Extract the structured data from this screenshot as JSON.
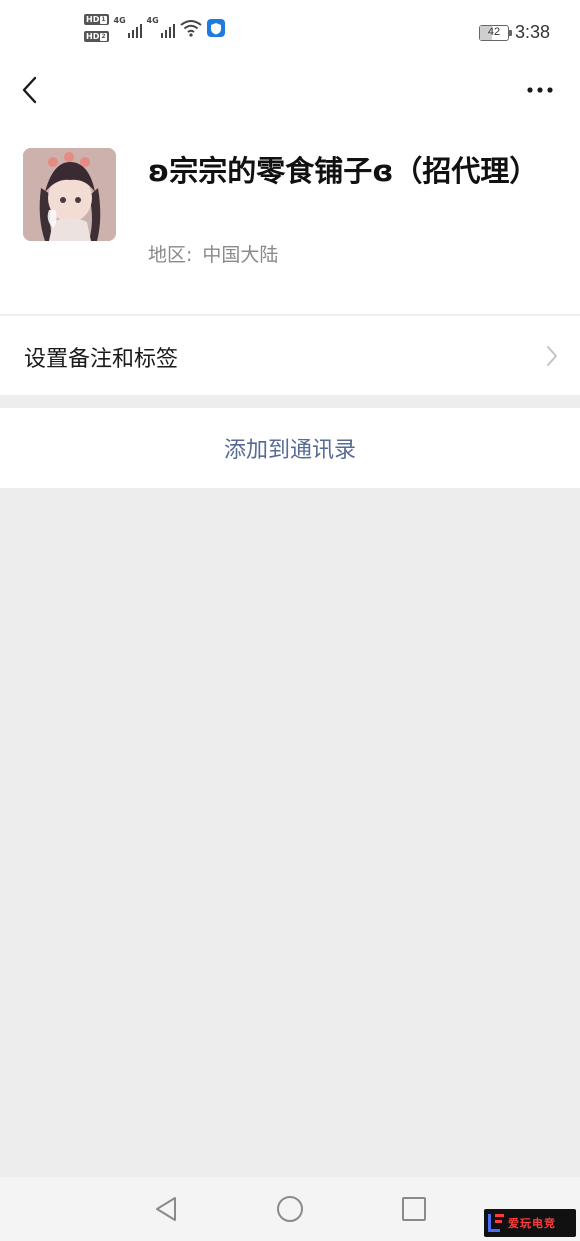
{
  "status_bar": {
    "sim1_label": "HD",
    "sim1_index": "1",
    "sim2_label": "HD",
    "sim2_index": "2",
    "network1": "4G",
    "network2": "4G",
    "battery_level": "42",
    "time": "3:38",
    "icons": [
      "hd-sim1-icon",
      "hd-sim2-icon",
      "signal-icon",
      "signal-icon",
      "wifi-icon",
      "shield-icon",
      "battery-icon"
    ]
  },
  "nav": {
    "back_icon": "chevron-left-icon",
    "more_icon": "more-dots-icon"
  },
  "profile": {
    "nickname": "ʚ宗宗的零食铺子ɞ（招代理）",
    "region_label": "地区:",
    "region_value": "中国大陆"
  },
  "remark": {
    "label": "设置备注和标签",
    "icon": "chevron-right-icon"
  },
  "add_contact": {
    "label": "添加到通讯录"
  },
  "colors": {
    "link": "#576b95",
    "page_bg": "#ededed",
    "card_bg": "#ffffff",
    "secondary_text": "#8a8a8a"
  },
  "system_nav": {
    "icons": [
      "back-triangle-icon",
      "home-circle-icon",
      "recents-square-icon"
    ]
  },
  "watermark": {
    "text": "爱玩电竞"
  }
}
